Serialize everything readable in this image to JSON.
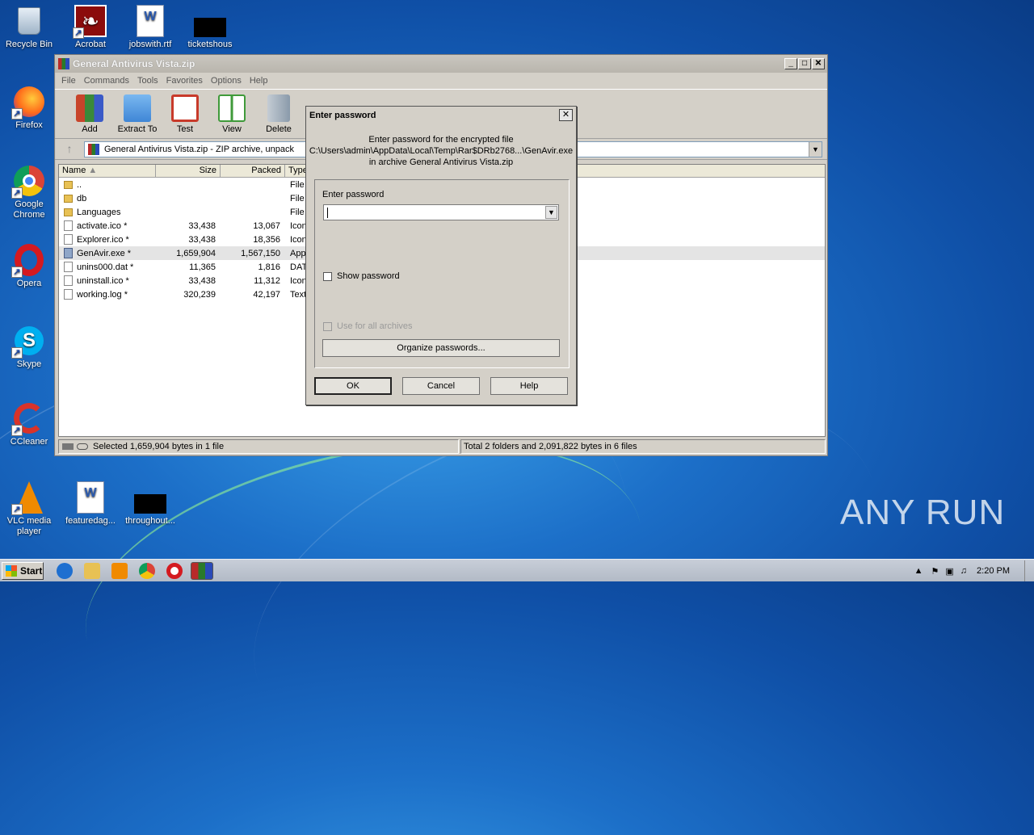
{
  "desktop": {
    "icons": [
      {
        "label": "Recycle Bin",
        "icon": "recycle-bin-icon"
      },
      {
        "label": "Acrobat",
        "icon": "acrobat-icon"
      },
      {
        "label": "jobswith.rtf",
        "icon": "word-doc-icon"
      },
      {
        "label": "ticketshous",
        "icon": "redacted-icon"
      },
      {
        "label": "Firefox",
        "icon": "firefox-icon"
      },
      {
        "label": "Google Chrome",
        "icon": "chrome-icon"
      },
      {
        "label": "Opera",
        "icon": "opera-icon"
      },
      {
        "label": "Skype",
        "icon": "skype-icon"
      },
      {
        "label": "CCleaner",
        "icon": "ccleaner-icon"
      },
      {
        "label": "VLC media player",
        "icon": "vlc-icon"
      },
      {
        "label": "featuredag...",
        "icon": "word-doc-icon"
      },
      {
        "label": "throughout...",
        "icon": "redacted-icon"
      }
    ],
    "watermark": "ANY RUN"
  },
  "winrar": {
    "title": "General Antivirus Vista.zip",
    "menu": [
      "File",
      "Commands",
      "Tools",
      "Favorites",
      "Options",
      "Help"
    ],
    "toolbar": [
      {
        "label": "Add",
        "icon": "add-archive-icon",
        "color": "#c8442a"
      },
      {
        "label": "Extract To",
        "icon": "extract-folder-icon",
        "color": "#3f86d6"
      },
      {
        "label": "Test",
        "icon": "test-clipboard-icon",
        "color": "#c83a2a"
      },
      {
        "label": "View",
        "icon": "view-book-icon",
        "color": "#3f9a3a"
      },
      {
        "label": "Delete",
        "icon": "delete-bin-icon",
        "color": "#8a9aaa"
      }
    ],
    "address": "General Antivirus Vista.zip - ZIP archive, unpack",
    "columns": {
      "name": "Name",
      "size": "Size",
      "packed": "Packed",
      "type": "Type"
    },
    "files": [
      {
        "name": "..",
        "size": "",
        "packed": "",
        "type": "File",
        "kind": "folder"
      },
      {
        "name": "db",
        "size": "",
        "packed": "",
        "type": "File",
        "kind": "folder"
      },
      {
        "name": "Languages",
        "size": "",
        "packed": "",
        "type": "File",
        "kind": "folder"
      },
      {
        "name": "activate.ico *",
        "size": "33,438",
        "packed": "13,067",
        "type": "Icon",
        "kind": "doc"
      },
      {
        "name": "Explorer.ico *",
        "size": "33,438",
        "packed": "18,356",
        "type": "Icon",
        "kind": "doc"
      },
      {
        "name": "GenAvir.exe *",
        "size": "1,659,904",
        "packed": "1,567,150",
        "type": "Appl",
        "kind": "exe",
        "selected": true
      },
      {
        "name": "unins000.dat *",
        "size": "11,365",
        "packed": "1,816",
        "type": "DAT",
        "kind": "doc"
      },
      {
        "name": "uninstall.ico *",
        "size": "33,438",
        "packed": "11,312",
        "type": "Icon",
        "kind": "doc"
      },
      {
        "name": "working.log *",
        "size": "320,239",
        "packed": "42,197",
        "type": "Text",
        "kind": "doc"
      }
    ],
    "status_left": "Selected 1,659,904 bytes in 1 file",
    "status_right": "Total 2 folders and 2,091,822 bytes in 6 files"
  },
  "dialog": {
    "title": "Enter password",
    "message_line1": "Enter password for the encrypted file",
    "message_line2": "C:\\Users\\admin\\AppData\\Local\\Temp\\Rar$DRb2768...\\GenAvir.exe",
    "message_line3": "in archive General Antivirus Vista.zip",
    "password_label": "Enter password",
    "password_value": "",
    "show_password": "Show password",
    "use_for_all": "Use for all archives",
    "organize": "Organize passwords...",
    "ok": "OK",
    "cancel": "Cancel",
    "help": "Help"
  },
  "taskbar": {
    "start": "Start",
    "clock": "2:20 PM"
  }
}
